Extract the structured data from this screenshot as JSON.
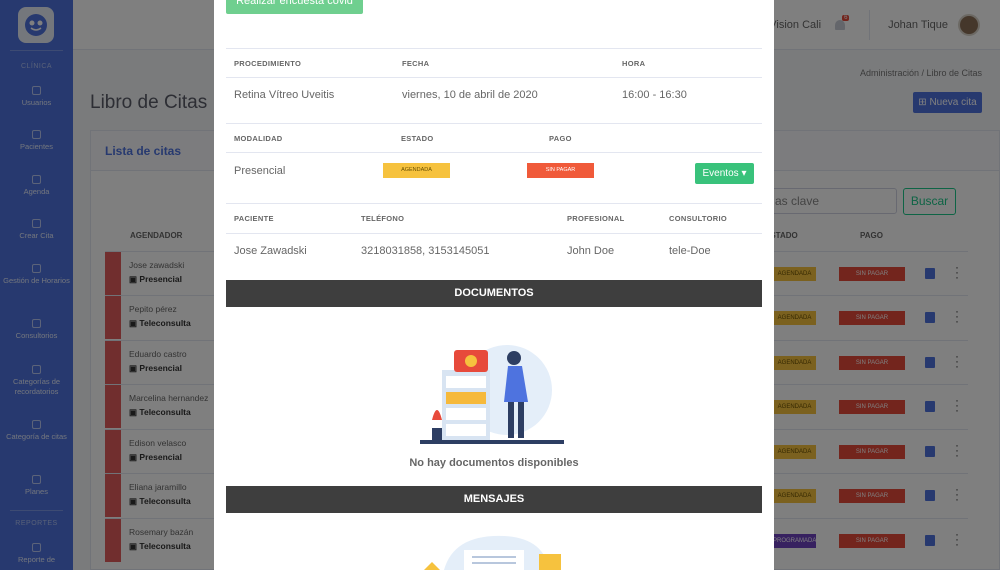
{
  "sidebar": {
    "section_clinica": "CLÍNICA",
    "section_reportes": "REPORTES",
    "items": [
      {
        "label": "Usuarios"
      },
      {
        "label": "Pacientes"
      },
      {
        "label": "Agenda"
      },
      {
        "label": "Crear Cita"
      },
      {
        "label": "Gestión de Horarios"
      },
      {
        "label": "Consultorios"
      },
      {
        "label": "Categorías de recordatorios"
      },
      {
        "label": "Categoría de citas"
      },
      {
        "label": "Planes"
      },
      {
        "label": "Reporte de"
      }
    ]
  },
  "topbar": {
    "org": "Vision Cali",
    "notifications": "6",
    "user": "Johan Tique"
  },
  "breadcrumb": "Administración / Libro de Citas",
  "page_title": "Libro de Citas",
  "new_button": "Nueva cita",
  "card_title": "Lista de citas",
  "search": {
    "value": "as clave",
    "button": "Buscar"
  },
  "table": {
    "headers": {
      "agendador": "AGENDADOR",
      "estado": "ESTADO",
      "pago": "PAGO"
    },
    "rows": [
      {
        "name": "Jose zawadski",
        "modality": "Presencial",
        "estado": "AGENDADA",
        "pago": "SIN PAGAR"
      },
      {
        "name": "Pepito pérez",
        "modality": "Teleconsulta",
        "estado": "AGENDADA",
        "pago": "SIN PAGAR"
      },
      {
        "name": "Eduardo castro",
        "modality": "Presencial",
        "estado": "AGENDADA",
        "pago": "SIN PAGAR"
      },
      {
        "name": "Marcelina hernandez",
        "modality": "Teleconsulta",
        "estado": "AGENDADA",
        "pago": "SIN PAGAR"
      },
      {
        "name": "Edison velasco",
        "modality": "Presencial",
        "estado": "AGENDADA",
        "pago": "SIN PAGAR"
      },
      {
        "name": "Eliana jaramillo",
        "modality": "Teleconsulta",
        "estado": "AGENDADA",
        "pago": "SIN PAGAR"
      },
      {
        "name": "Rosemary bazán",
        "modality": "Teleconsulta",
        "estado": "PROGRAMADA",
        "pago": "SIN PAGAR"
      }
    ]
  },
  "modal": {
    "survey_button": "Realizar encuesta covid",
    "labels": {
      "procedimiento": "PROCEDIMIENTO",
      "fecha": "FECHA",
      "hora": "HORA",
      "modalidad": "MODALIDAD",
      "estado": "ESTADO",
      "pago": "PAGO",
      "paciente": "PACIENTE",
      "telefono": "TELÉFONO",
      "profesional": "PROFESIONAL",
      "consultorio": "CONSULTORIO"
    },
    "values": {
      "procedimiento": "Retina Vítreo Uveitis",
      "fecha": "viernes, 10 de abril de 2020",
      "hora": "16:00 - 16:30",
      "modalidad": "Presencial",
      "estado": "AGENDADA",
      "pago": "SIN PAGAR",
      "paciente": "Jose Zawadski",
      "telefono": "3218031858, 3153145051",
      "profesional": "John Doe",
      "consultorio": "tele-Doe"
    },
    "eventos_button": "Eventos",
    "documents_title": "DOCUMENTOS",
    "no_documents": "No hay documentos disponibles",
    "messages_title": "MENSAJES"
  },
  "colors": {
    "primary": "#4e73df",
    "success": "#39c27b",
    "warning": "#f6c23e",
    "danger": "#e74a3b",
    "dark_bar": "#3e3e3e"
  }
}
